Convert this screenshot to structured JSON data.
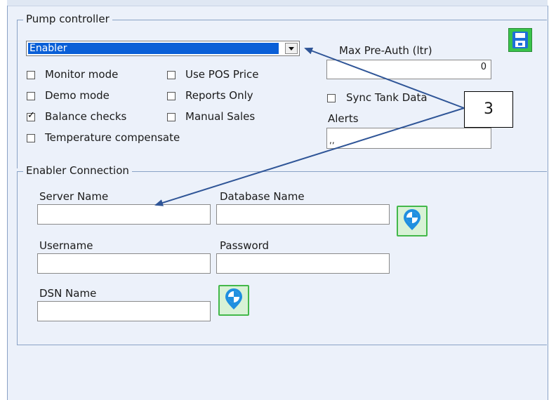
{
  "pump_controller": {
    "legend": "Pump controller",
    "selected_controller": "Enabler",
    "checkboxes": [
      {
        "label": "Monitor mode",
        "checked": false
      },
      {
        "label": "Demo mode",
        "checked": false
      },
      {
        "label": "Balance checks",
        "checked": true
      },
      {
        "label": "Temperature compensate",
        "checked": false
      },
      {
        "label": "Use POS Price",
        "checked": false
      },
      {
        "label": "Reports Only",
        "checked": false
      },
      {
        "label": "Manual Sales",
        "checked": false
      }
    ],
    "max_preauth_label": "Max Pre-Auth (ltr)",
    "max_preauth_value": "0",
    "sync_tank": {
      "label": "Sync Tank Data",
      "checked": false
    },
    "alerts_label": "Alerts",
    "alerts_value": ",,"
  },
  "enabler_connection": {
    "legend": "Enabler Connection",
    "server_name_label": "Server Name",
    "server_name_value": "",
    "database_name_label": "Database Name",
    "database_name_value": "",
    "username_label": "Username",
    "username_value": "",
    "password_label": "Password",
    "password_value": "",
    "dsn_name_label": "DSN Name",
    "dsn_name_value": ""
  },
  "annotation": {
    "callout_number": "3"
  },
  "icons": {
    "save": "floppy-disk-icon",
    "connection": "globe-pin-icon"
  },
  "colors": {
    "selection": "#0a5fd7",
    "panel": "#ecf1fa",
    "button_green": "#43b84a",
    "annotation_arrow": "#2f5597"
  }
}
